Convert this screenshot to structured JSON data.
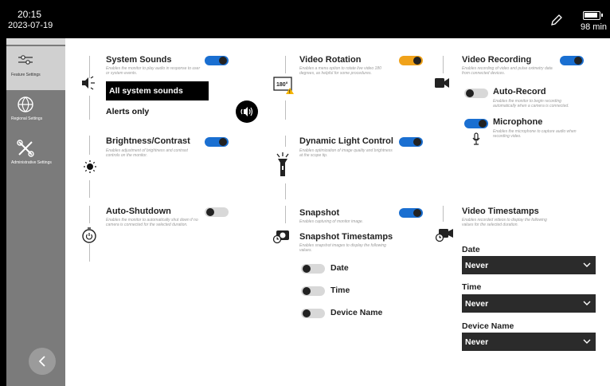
{
  "status_bar": {
    "time": "20:15",
    "date": "2023-07-19",
    "battery_text": "98 min"
  },
  "sidebar": {
    "items": [
      {
        "label": "Feature Settings",
        "icon": "sliders-icon"
      },
      {
        "label": "Regional Settings",
        "icon": "globe-icon"
      },
      {
        "label": "Administrative Settings",
        "icon": "tools-icon"
      }
    ]
  },
  "settings": {
    "system_sounds": {
      "title": "System Sounds",
      "desc": "Enables the monitor to play audio in response to user or system events.",
      "enabled": true,
      "options": [
        "All system sounds",
        "Alerts only"
      ],
      "selected": "All system sounds"
    },
    "brightness_contrast": {
      "title": "Brightness/Contrast",
      "desc": "Enables adjustment of brightness and contrast controls on the monitor.",
      "enabled": true
    },
    "auto_shutdown": {
      "title": "Auto-Shutdown",
      "desc": "Enables the monitor to automatically shut down if no camera is connected for the selected duration.",
      "enabled": false
    },
    "video_rotation": {
      "title": "Video Rotation",
      "desc": "Enables a menu option to rotate live video 180 degrees, as helpful for some procedures.",
      "enabled": true,
      "icon_text": "180°"
    },
    "dynamic_light_control": {
      "title": "Dynamic Light Control",
      "desc": "Enables optimization of image quality and brightness at the scope tip.",
      "enabled": true
    },
    "snapshot": {
      "title": "Snapshot",
      "desc": "Enables capturing of monitor image.",
      "enabled": true
    },
    "snapshot_timestamps": {
      "title": "Snapshot Timestamps",
      "desc": "Enables snapshot images to display the following values.",
      "items": [
        {
          "label": "Date",
          "enabled": false
        },
        {
          "label": "Time",
          "enabled": false
        },
        {
          "label": "Device Name",
          "enabled": false
        }
      ]
    },
    "video_recording": {
      "title": "Video Recording",
      "desc": "Enables recording of video and pulse oximetry data from connected devices.",
      "enabled": true,
      "auto_record": {
        "title": "Auto-Record",
        "desc": "Enables the monitor to begin recording automatically when a camera is connected.",
        "enabled": false
      },
      "microphone": {
        "title": "Microphone",
        "desc": "Enables the microphone to capture audio when recording video.",
        "enabled": true
      }
    },
    "video_timestamps": {
      "title": "Video Timestamps",
      "desc": "Enables recorded videos to display the following values for the selected duration.",
      "fields": [
        {
          "label": "Date",
          "value": "Never"
        },
        {
          "label": "Time",
          "value": "Never"
        },
        {
          "label": "Device Name",
          "value": "Never"
        }
      ]
    }
  },
  "colors": {
    "toggle_on": "#1a6fd1",
    "toggle_warning": "#f0a21a",
    "sidebar": "#7b7b7b",
    "warning_icon": "#f5b400"
  }
}
